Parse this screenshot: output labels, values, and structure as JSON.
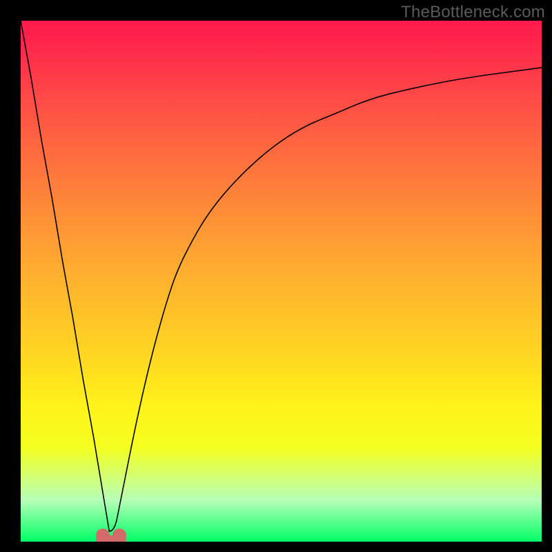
{
  "watermark": "TheBottleneck.com",
  "colors": {
    "page_bg": "#000000",
    "gradient_top": "#ff1a4d",
    "gradient_bottom": "#00ff66",
    "curve": "#000000",
    "marker": "#d26a6a"
  },
  "chart_data": {
    "type": "line",
    "title": "",
    "xlabel": "",
    "ylabel": "",
    "xlim": [
      0,
      100
    ],
    "ylim": [
      0,
      100
    ],
    "grid": false,
    "legend": false,
    "annotations": [
      "TheBottleneck.com"
    ],
    "description": "V-shaped bottleneck curve with steep linear drop from upper left to a minimum near x≈17, then a concave rise asymptotically approaching the top toward the right edge. Background is a vertical red→yellow→green gradient representing bottleneck severity (top=worst, bottom=best). Two small rounded markers sit at the valley on the baseline.",
    "series": [
      {
        "name": "bottleneck-curve",
        "x": [
          0,
          2,
          4,
          6,
          8,
          10,
          12,
          14,
          15,
          16,
          17,
          18,
          19,
          20,
          22,
          24,
          26,
          28,
          30,
          33,
          36,
          40,
          45,
          50,
          55,
          60,
          67,
          75,
          85,
          100
        ],
        "y": [
          100,
          89,
          77,
          66,
          54,
          43,
          31,
          20,
          14,
          8,
          2,
          2,
          7,
          12,
          22,
          31,
          39,
          46,
          52,
          58,
          63,
          68,
          73,
          77,
          80,
          82,
          85,
          87,
          89,
          91
        ]
      }
    ],
    "markers": [
      {
        "x": 15.8,
        "y": 0,
        "shape": "circle"
      },
      {
        "x": 19.0,
        "y": 0,
        "shape": "circle"
      }
    ]
  }
}
